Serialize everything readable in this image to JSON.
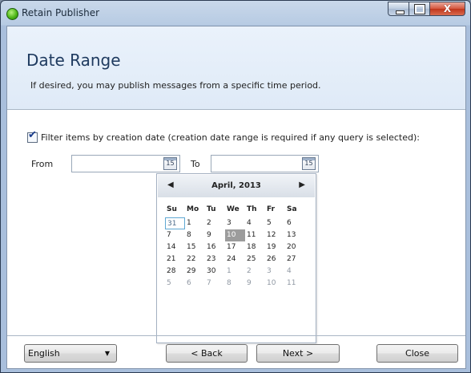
{
  "window": {
    "title": "Retain Publisher",
    "close_glyph": "X"
  },
  "header": {
    "title": "Date Range",
    "subtitle": "If desired, you may publish messages from a specific time period."
  },
  "filter": {
    "checked": true,
    "check_glyph": "✔",
    "label": "Filter items by creation date (creation date range is required if any query is selected):"
  },
  "from": {
    "label": "From",
    "value": "",
    "calendar_button": "15"
  },
  "to": {
    "label": "To",
    "value": "",
    "calendar_button": "15"
  },
  "calendar": {
    "prev_glyph": "◀",
    "next_glyph": "▶",
    "month_label": "April, 2013",
    "days_of_week": [
      "Su",
      "Mo",
      "Tu",
      "We",
      "Th",
      "Fr",
      "Sa"
    ],
    "today": "31",
    "selected": "10",
    "weeks": [
      [
        "31",
        "1",
        "2",
        "3",
        "4",
        "5",
        "6"
      ],
      [
        "7",
        "8",
        "9",
        "10",
        "11",
        "12",
        "13"
      ],
      [
        "14",
        "15",
        "16",
        "17",
        "18",
        "19",
        "20"
      ],
      [
        "21",
        "22",
        "23",
        "24",
        "25",
        "26",
        "27"
      ],
      [
        "28",
        "29",
        "30",
        "1",
        "2",
        "3",
        "4"
      ],
      [
        "5",
        "6",
        "7",
        "8",
        "9",
        "10",
        "11"
      ]
    ]
  },
  "footer": {
    "language": "English",
    "language_arrow": "▼",
    "back_label": "< Back",
    "next_label": "Next >",
    "close_label": "Close"
  }
}
